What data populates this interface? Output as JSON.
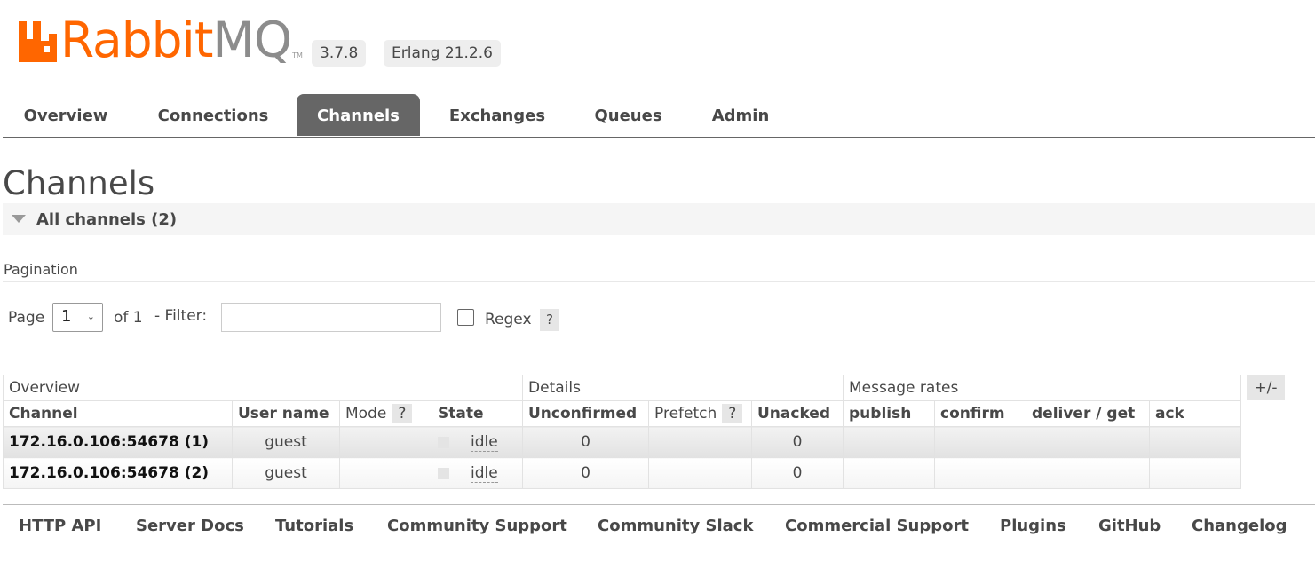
{
  "header": {
    "logo_rabbit": "Rabbit",
    "logo_mq": "MQ",
    "logo_tm": "TM",
    "version": "3.7.8",
    "erlang": "Erlang 21.2.6"
  },
  "tabs": [
    {
      "label": "Overview"
    },
    {
      "label": "Connections"
    },
    {
      "label": "Channels"
    },
    {
      "label": "Exchanges"
    },
    {
      "label": "Queues"
    },
    {
      "label": "Admin"
    }
  ],
  "active_tab": "Channels",
  "page": {
    "title": "Channels",
    "section": "All channels (2)",
    "pagination_label": "Pagination",
    "page_label": "Page",
    "page_value": "1",
    "of_label": "of 1",
    "filter_label": "- Filter:",
    "filter_value": "",
    "regex_label": "Regex",
    "help": "?"
  },
  "table": {
    "groups": [
      "Overview",
      "Details",
      "Message rates"
    ],
    "columns": [
      "Channel",
      "User name",
      "Mode",
      "State",
      "Unconfirmed",
      "Prefetch",
      "Unacked",
      "publish",
      "confirm",
      "deliver / get",
      "ack"
    ],
    "plusminus": "+/-",
    "rows": [
      {
        "channel": "172.16.0.106:54678 (1)",
        "user": "guest",
        "mode": "",
        "state": "idle",
        "unconfirmed": "0",
        "prefetch": "",
        "unacked": "0",
        "publish": "",
        "confirm": "",
        "deliver_get": "",
        "ack": ""
      },
      {
        "channel": "172.16.0.106:54678 (2)",
        "user": "guest",
        "mode": "",
        "state": "idle",
        "unconfirmed": "0",
        "prefetch": "",
        "unacked": "0",
        "publish": "",
        "confirm": "",
        "deliver_get": "",
        "ack": ""
      }
    ]
  },
  "footer": [
    "HTTP API",
    "Server Docs",
    "Tutorials",
    "Community Support",
    "Community Slack",
    "Commercial Support",
    "Plugins",
    "GitHub",
    "Changelog"
  ],
  "colors": {
    "brand_orange": "#ff6600",
    "active_tab": "#666666"
  }
}
